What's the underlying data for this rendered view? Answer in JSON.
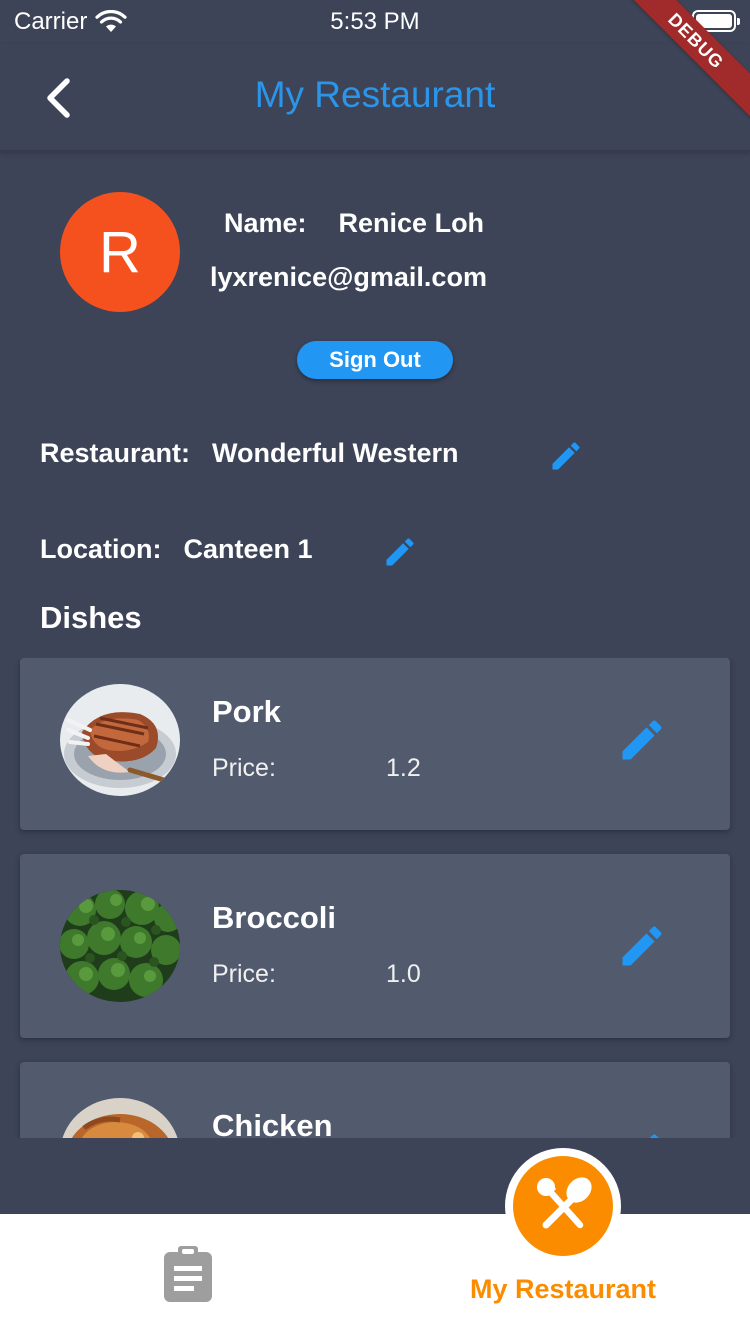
{
  "status_bar": {
    "carrier": "Carrier",
    "time": "5:53 PM"
  },
  "debug_banner": "DEBUG",
  "app_bar": {
    "title": "My Restaurant",
    "back_icon": "chevron-left-icon"
  },
  "profile": {
    "avatar_letter": "R",
    "avatar_color": "#f4511e",
    "name_label": "Name:",
    "name_value": "Renice Loh",
    "email": "lyxrenice@gmail.com",
    "sign_out_label": "Sign Out"
  },
  "restaurant": {
    "label": "Restaurant:",
    "value": "Wonderful Western",
    "edit_icon": "pencil-icon"
  },
  "location": {
    "label": "Location:",
    "value": "Canteen 1",
    "edit_icon": "pencil-icon"
  },
  "dishes_title": "Dishes",
  "dishes": [
    {
      "name": "Pork",
      "price_label": "Price:",
      "price": "1.2",
      "image": "roast-pork-photo"
    },
    {
      "name": "Broccoli",
      "price_label": "Price:",
      "price": "1.0",
      "image": "broccoli-photo"
    },
    {
      "name": "Chicken",
      "price_label": "",
      "price": "",
      "image": "roast-chicken-photo"
    }
  ],
  "bottom_nav": {
    "items": [
      {
        "icon": "clipboard-icon",
        "label": "",
        "active": false
      },
      {
        "icon": "fork-spoon-icon",
        "label": "My Restaurant",
        "active": true
      }
    ]
  },
  "colors": {
    "background": "#3d4458",
    "card": "#525a6e",
    "accent_blue": "#2196f3",
    "accent_orange": "#fb8c00",
    "debug_ribbon": "#a12a2a"
  }
}
